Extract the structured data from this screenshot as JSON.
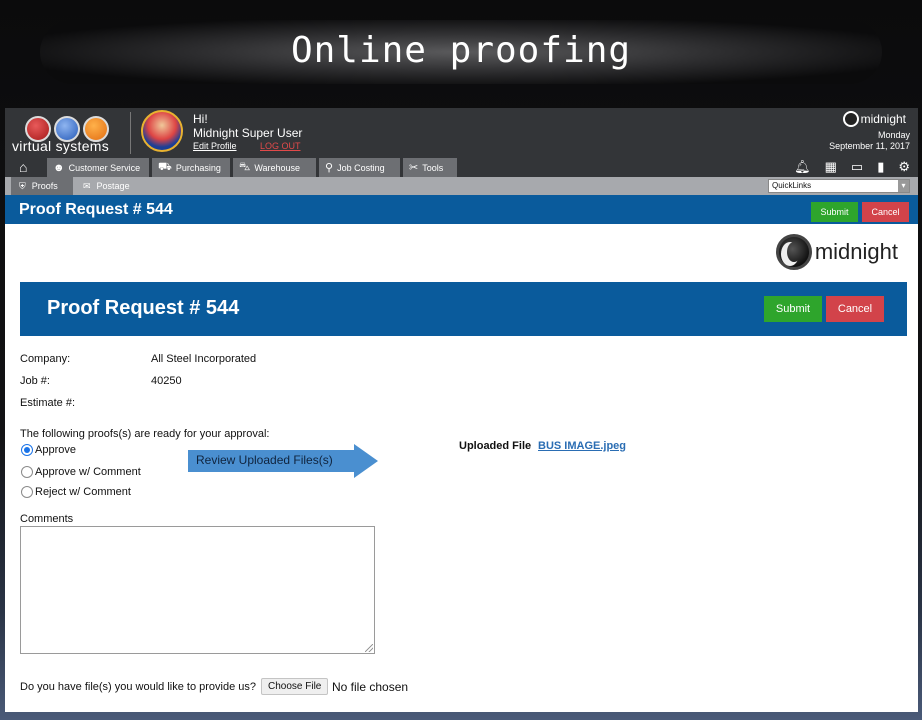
{
  "slide": {
    "title": "Online proofing"
  },
  "header": {
    "brand_text": "virtual systems",
    "greeting": "Hi!",
    "username": "Midnight Super User",
    "edit_profile": "Edit Profile",
    "logout": "LOG OUT",
    "brand_small": "midnight",
    "day": "Monday",
    "date": "September 11, 2017"
  },
  "nav": {
    "tabs": [
      {
        "label": "Customer Service",
        "icon": "person-icon"
      },
      {
        "label": "Purchasing",
        "icon": "cart-icon"
      },
      {
        "label": "Warehouse",
        "icon": "truck-icon"
      },
      {
        "label": "Job Costing",
        "icon": "magnifier-icon"
      },
      {
        "label": "Tools",
        "icon": "tools-icon"
      }
    ],
    "right_icons": [
      "bell-icon",
      "calendar-icon",
      "monitor-icon",
      "document-icon",
      "gear-icon"
    ]
  },
  "subnav": {
    "tabs": [
      {
        "label": "Proofs",
        "icon": "shield-icon",
        "active": true
      },
      {
        "label": "Postage",
        "icon": "postage-icon",
        "active": false
      }
    ],
    "quicklinks": "QuickLinks"
  },
  "titlestrip": {
    "title": "Proof Request # 544",
    "submit": "Submit",
    "cancel": "Cancel"
  },
  "form": {
    "brand_big": "midnight",
    "title": "Proof Request # 544",
    "submit": "Submit",
    "cancel": "Cancel",
    "company_label": "Company:",
    "company_value": "All Steel Incorporated",
    "job_label": "Job #:",
    "job_value": "40250",
    "estimate_label": "Estimate #:",
    "estimate_value": "",
    "proofs_intro": "The following proofs(s) are ready for your approval:",
    "options": [
      {
        "label": "Approve",
        "checked": true
      },
      {
        "label": "Approve w/ Comment",
        "checked": false
      },
      {
        "label": "Reject w/ Comment",
        "checked": false
      }
    ],
    "arrow_callout": "Review Uploaded Files(s)",
    "uploaded_label": "Uploaded File",
    "uploaded_file": "BUS IMAGE.jpeg",
    "comments_label": "Comments",
    "comments_value": "",
    "file_question": "Do you have file(s) you would like to provide us?",
    "choose_file": "Choose File",
    "no_file": "No file chosen"
  },
  "colors": {
    "header_bg": "#333538",
    "tab_bg": "#6d6f73",
    "subbar_bg": "#a7a9ad",
    "primary_blue": "#0a5b9c",
    "submit_green": "#2ea52c",
    "cancel_red": "#d2434a",
    "callout_blue": "#4a8fd0",
    "link_blue": "#2a6db3"
  }
}
